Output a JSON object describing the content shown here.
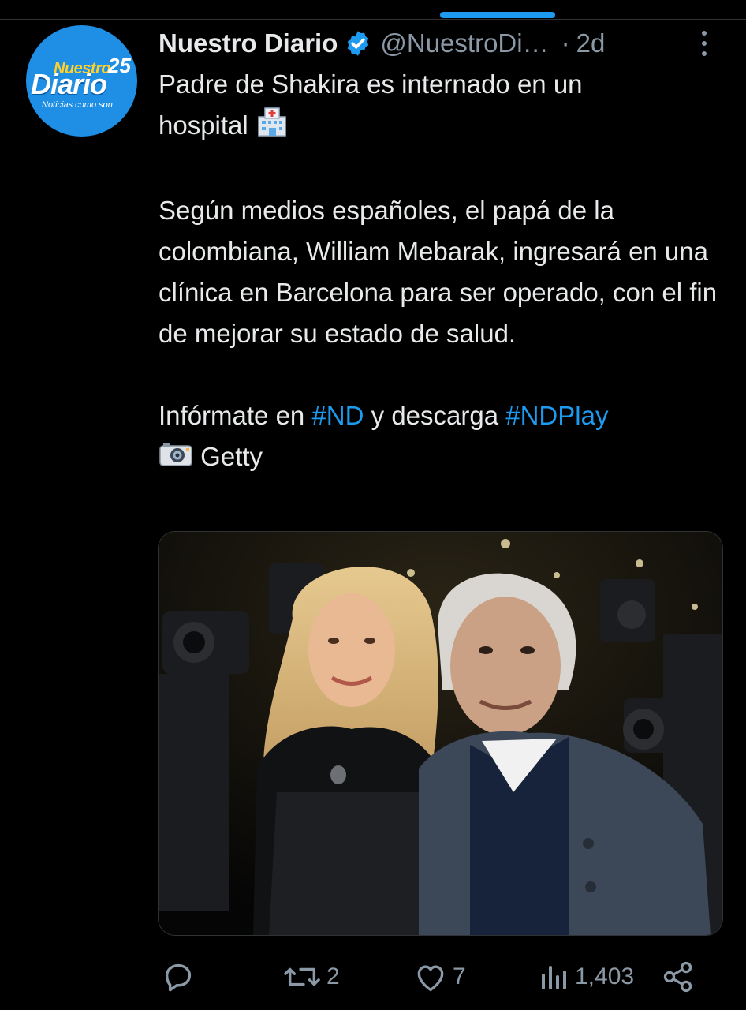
{
  "account": {
    "display_name": "Nuestro Diario",
    "handle": "@NuestroDi…",
    "separator": "·",
    "time": "2d",
    "avatar_logo": {
      "top": "Nuestro",
      "main": "Diario",
      "anniversary": "25",
      "tagline": "Noticias como son"
    }
  },
  "tweet": {
    "line1": "Padre de Shakira es internado en un",
    "line2": "hospital",
    "paragraph2": "Según medios españoles, el papá de la colombiana, William Mebarak, ingresará en una clínica en Barcelona para ser operado, con el fin de mejorar su estado de salud.",
    "line_pre": "Infórmate en ",
    "hashtag1": "#ND",
    "line_mid": " y descarga ",
    "hashtag2": "#NDPlay",
    "credit": "Getty",
    "icons": [
      "hospital-emoji",
      "camera-emoji"
    ]
  },
  "actions": {
    "reply_count": "",
    "retweet_count": "2",
    "like_count": "7",
    "views_count": "1,403"
  },
  "colors": {
    "background": "#000000",
    "text": "#e7e9ea",
    "secondary": "#8b98a5",
    "accent": "#1d9bf0"
  }
}
